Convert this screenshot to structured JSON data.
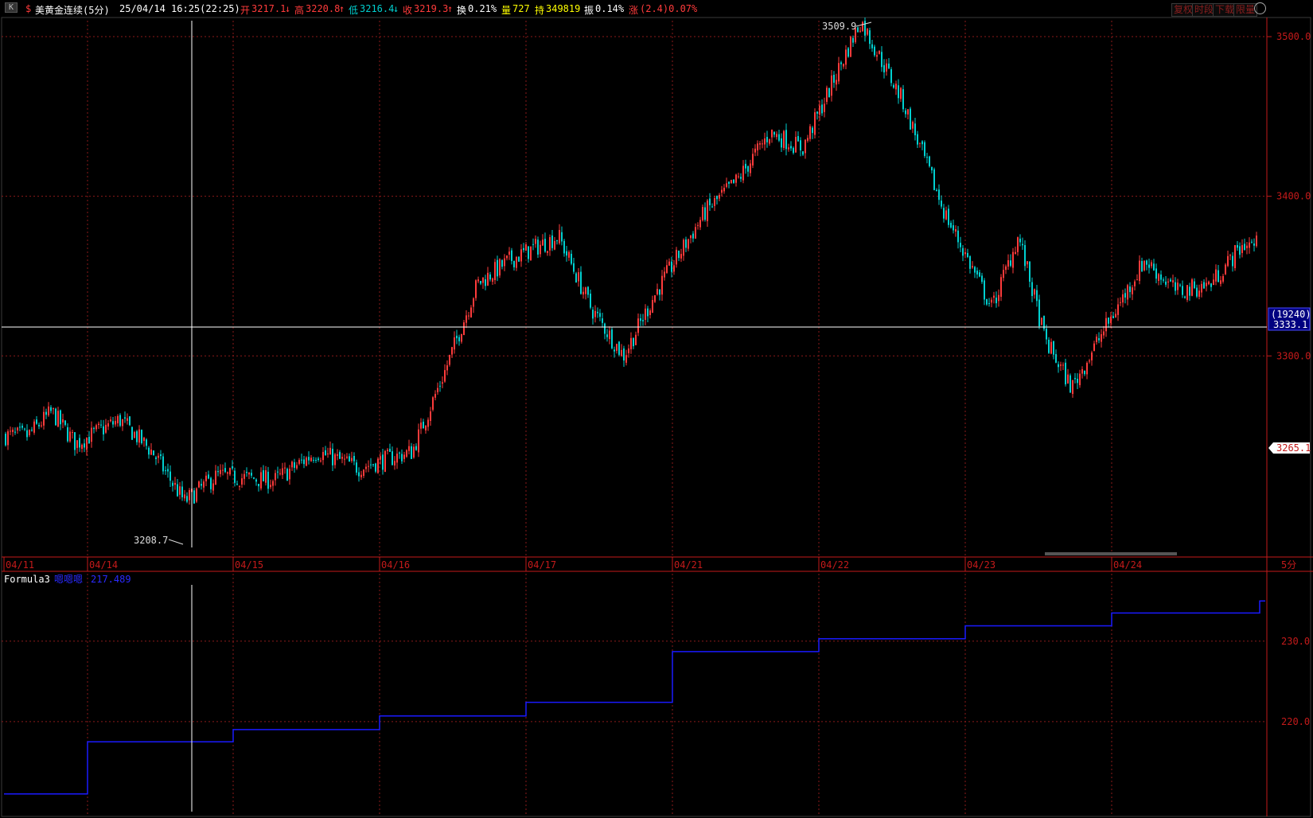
{
  "header": {
    "k_badge": "K",
    "dollar_icon": "$",
    "symbol": "美黄金连续(5分)",
    "datetime": "25/04/14 16:25(22:25)",
    "open_label": "开",
    "open_value": "3217.1",
    "open_arrow": "↓",
    "high_label": "高",
    "high_value": "3220.8",
    "high_arrow": "↑",
    "low_label": "低",
    "low_value": "3216.4",
    "low_arrow": "↓",
    "close_label": "收",
    "close_value": "3219.3",
    "close_arrow": "↑",
    "turnover_label": "换",
    "turnover_value": "0.21%",
    "volume_label": "量",
    "volume_value": "727",
    "oi_label": "持",
    "oi_value": "349819",
    "amp_label": "振",
    "amp_value": "0.14%",
    "chg_label": "涨",
    "chg_value": "(2.4)0.07%",
    "buttons": [
      "复权",
      "时段",
      "下载",
      "限量"
    ],
    "clock_icon": "clock-icon"
  },
  "colors": {
    "up": "#ff3b3b",
    "down": "#00d0d0",
    "grid": "#8b1a1a",
    "axis": "#c41a1a",
    "indicator_line": "#1a1aff",
    "crosshair": "#ffffff"
  },
  "price_axis": {
    "ticks": [
      "3500.0",
      "3400.0",
      "3300.0"
    ],
    "crosshair_count": "(19240)",
    "crosshair_price": "3333.1",
    "last_price": "3265.1",
    "high_marker": "3509.9",
    "low_marker": "3208.7"
  },
  "date_axis": {
    "labels": [
      "04/11",
      "04/14",
      "04/15",
      "04/16",
      "04/17",
      "04/21",
      "04/22",
      "04/23",
      "04/24"
    ],
    "period": "5分"
  },
  "indicator": {
    "name": "Formula3",
    "series_name": "嗯嗯嗯",
    "value": "217.489",
    "ticks": [
      "230.0",
      "220.0"
    ]
  },
  "chart_data": {
    "type": "candlestick",
    "title": "美黄金连续(5分)",
    "x": [
      "04/11",
      "04/14",
      "04/15",
      "04/16",
      "04/17",
      "04/21",
      "04/22",
      "04/23",
      "04/24"
    ],
    "price_path": [
      [
        "04/11",
        3250
      ],
      [
        "04/11",
        3265
      ],
      [
        "04/11",
        3245
      ],
      [
        "04/14",
        3260
      ],
      [
        "04/14",
        3240
      ],
      [
        "04/14",
        3208.7
      ],
      [
        "04/14",
        3225
      ],
      [
        "04/15",
        3222
      ],
      [
        "04/15",
        3240
      ],
      [
        "04/15",
        3230
      ],
      [
        "04/16",
        3240
      ],
      [
        "04/16",
        3290
      ],
      [
        "04/16",
        3345
      ],
      [
        "04/16",
        3360
      ],
      [
        "04/17",
        3375
      ],
      [
        "04/17",
        3330
      ],
      [
        "04/17",
        3300
      ],
      [
        "04/17",
        3340
      ],
      [
        "04/21",
        3390
      ],
      [
        "04/21",
        3410
      ],
      [
        "04/21",
        3440
      ],
      [
        "04/21",
        3430
      ],
      [
        "04/22",
        3509.9
      ],
      [
        "04/22",
        3460
      ],
      [
        "04/22",
        3390
      ],
      [
        "04/23",
        3330
      ],
      [
        "04/23",
        3375
      ],
      [
        "04/23",
        3310
      ],
      [
        "04/23",
        3280
      ],
      [
        "04/23",
        3310
      ],
      [
        "04/24",
        3360
      ],
      [
        "04/24",
        3340
      ],
      [
        "04/24",
        3345
      ],
      [
        "04/24",
        3370
      ]
    ],
    "ylim": [
      3180,
      3510
    ],
    "indicator_steps": [
      [
        "04/11",
        211.0
      ],
      [
        "04/14",
        217.489
      ],
      [
        "04/15",
        219.0
      ],
      [
        "04/16",
        220.7
      ],
      [
        "04/17",
        222.4
      ],
      [
        "04/21",
        228.7
      ],
      [
        "04/22",
        230.3
      ],
      [
        "04/23",
        231.9
      ],
      [
        "04/24",
        233.5
      ],
      [
        "04/24",
        235.0
      ]
    ],
    "indicator_ylim": [
      209,
      237
    ]
  }
}
